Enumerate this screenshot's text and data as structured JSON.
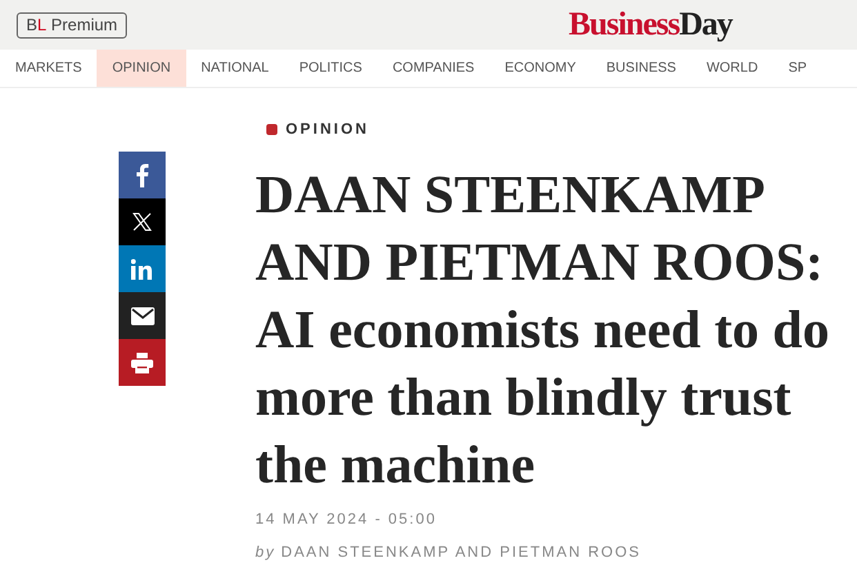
{
  "premium_badge": [
    {
      "text": "B",
      "color": "#444444"
    },
    {
      "text": "L",
      "color": "#d0021b"
    },
    {
      "text": " Premium",
      "color": "#444444"
    }
  ],
  "logo": [
    {
      "text": "Business",
      "color": "#c8102e"
    },
    {
      "text": "Day",
      "color": "#222222"
    }
  ],
  "nav": [
    {
      "label": "MARKETS",
      "selected": false
    },
    {
      "label": "OPINION",
      "selected": true
    },
    {
      "label": "NATIONAL",
      "selected": false
    },
    {
      "label": "POLITICS",
      "selected": false
    },
    {
      "label": "COMPANIES",
      "selected": false
    },
    {
      "label": "ECONOMY",
      "selected": false
    },
    {
      "label": "BUSINESS",
      "selected": false
    },
    {
      "label": "WORLD",
      "selected": false
    },
    {
      "label": "SP",
      "selected": false
    }
  ],
  "share": [
    {
      "kind": "facebook",
      "color": "#3b5998"
    },
    {
      "kind": "x",
      "color": "#000000"
    },
    {
      "kind": "linkedin",
      "color": "#0077b5"
    },
    {
      "kind": "email",
      "color": "#222222"
    },
    {
      "kind": "print",
      "color": "#b71c24"
    }
  ],
  "article": {
    "section": "OPINION",
    "headline": "DAAN STEENKAMP AND PIETMAN ROOS: AI economists need to do more than blindly trust the machine",
    "date": "14 MAY 2024 - 05:00",
    "byline_prefix": "by",
    "byline": "DAAN STEENKAMP AND PIETMAN ROOS"
  }
}
